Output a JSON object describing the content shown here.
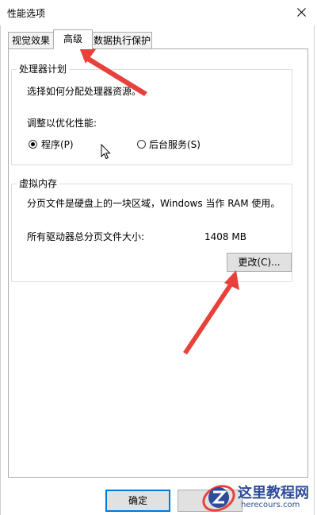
{
  "window": {
    "title": "性能选项"
  },
  "tabs": [
    {
      "label": "视觉效果",
      "active": false
    },
    {
      "label": "高级",
      "active": true
    },
    {
      "label": "数据执行保护",
      "active": false
    }
  ],
  "processor": {
    "legend": "处理器计划",
    "description": "选择如何分配处理器资源。",
    "adjust_label": "调整以优化性能:",
    "options": [
      {
        "label": "程序(P)",
        "selected": true
      },
      {
        "label": "后台服务(S)",
        "selected": false
      }
    ]
  },
  "virtual_memory": {
    "legend": "虚拟内存",
    "description": "分页文件是硬盘上的一块区域，Windows 当作 RAM 使用。",
    "total_label": "所有驱动器总分页文件大小:",
    "total_value": "1408 MB",
    "change_button": "更改(C)..."
  },
  "footer": {
    "ok_button": "确定",
    "cancel_button": ""
  },
  "watermark": {
    "title": "这里教程网",
    "url": "herecours.com"
  },
  "colors": {
    "annotation_arrow": "#e8413c",
    "watermark": "#2e4c9a",
    "accent_border": "#0078d7"
  }
}
